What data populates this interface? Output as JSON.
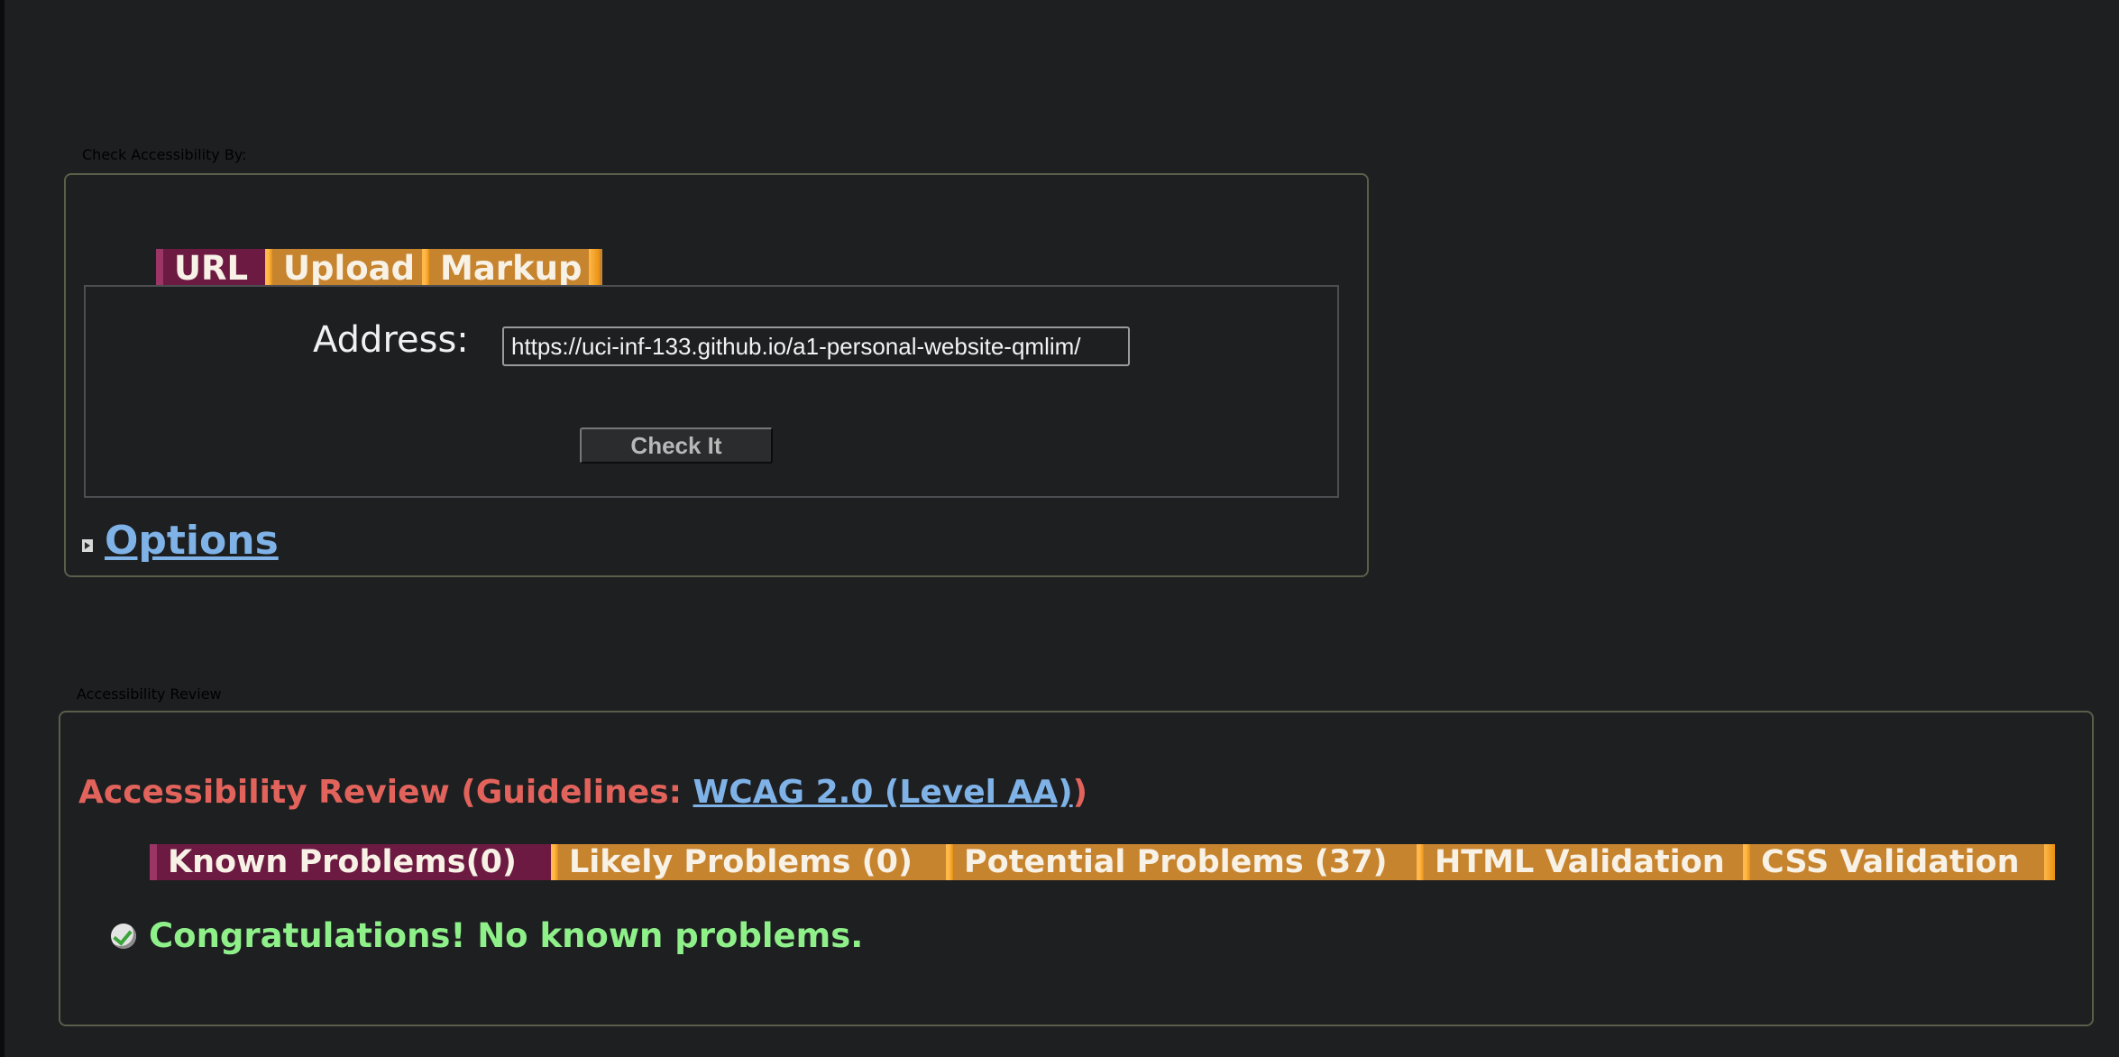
{
  "check_panel": {
    "legend": "Check Accessibility By:",
    "tabs": [
      {
        "label": "URL",
        "active": true
      },
      {
        "label": "Upload",
        "active": false
      },
      {
        "label": "Markup",
        "active": false
      }
    ],
    "address_label": "Address:",
    "address_value": "https://uci-inf-133.github.io/a1-personal-website-qmlim/",
    "check_button": "Check It",
    "options_link": "Options"
  },
  "review_panel": {
    "legend": "Accessibility Review",
    "heading_prefix": "Accessibility Review (Guidelines: ",
    "guideline_link": "WCAG 2.0 (Level AA)",
    "heading_suffix": ")",
    "tabs": [
      {
        "label": "Known Problems(0)",
        "active": true
      },
      {
        "label": "Likely Problems (0)",
        "active": false
      },
      {
        "label": "Potential Problems (37)",
        "active": false
      },
      {
        "label": "HTML Validation",
        "active": false
      },
      {
        "label": "CSS Validation",
        "active": false
      }
    ],
    "message": "Congratulations! No known problems."
  },
  "colors": {
    "background": "#1d1f21",
    "legend_bg": "#c7842f",
    "active_tab": "#6d1a42",
    "heading": "#e2635b",
    "link": "#7fb2e6",
    "success": "#8ff08a"
  },
  "icons": {
    "options_toggle": "expand-arrow-icon",
    "success": "checkmark-icon"
  }
}
